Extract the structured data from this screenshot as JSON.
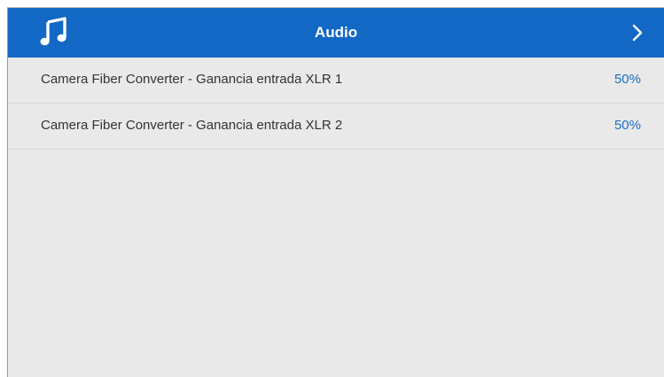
{
  "header": {
    "icon": "music-note-icon",
    "title": "Audio",
    "next_icon": "chevron-right-icon",
    "bg_color": "#1268c4"
  },
  "settings": [
    {
      "label": "Camera Fiber Converter - Ganancia entrada XLR 1",
      "value": "50%"
    },
    {
      "label": "Camera Fiber Converter - Ganancia entrada XLR 2",
      "value": "50%"
    }
  ],
  "colors": {
    "value_text": "#1a6fc8",
    "panel_bg": "#e9e9e9"
  }
}
